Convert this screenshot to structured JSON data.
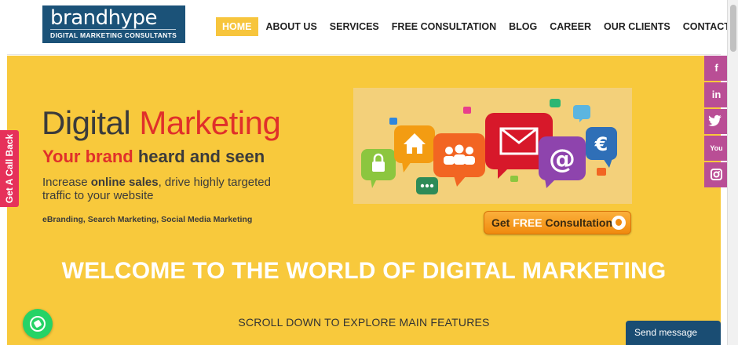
{
  "logo": {
    "wordmark_start": "brand",
    "wordmark_end": "hype",
    "tagline": "DIGITAL MARKETING CONSULTANTS",
    "background_color": "#1b5278"
  },
  "nav": {
    "items": [
      {
        "label": "HOME",
        "active": true
      },
      {
        "label": "ABOUT US",
        "active": false
      },
      {
        "label": "SERVICES",
        "active": false
      },
      {
        "label": "FREE CONSULTATION",
        "active": false
      },
      {
        "label": "BLOG",
        "active": false
      },
      {
        "label": "CAREER",
        "active": false
      },
      {
        "label": "OUR CLIENTS",
        "active": false
      },
      {
        "label": "CONTACT US",
        "active": false
      }
    ],
    "search_icon": "search-icon",
    "active_color": "#f7c53d"
  },
  "hero": {
    "background_color": "#f8c93c",
    "title_part1": "Digital ",
    "title_part2": "Marketing",
    "subtitle_part1": "Your brand ",
    "subtitle_part2": "heard and seen",
    "desc_part1": "Increase ",
    "desc_bold": "online sales",
    "desc_part2": ", drive highly targeted traffic to your website",
    "services_line": "eBranding, Search Marketing, Social Media Marketing",
    "cta_part1": "Get ",
    "cta_free": "FREE",
    "cta_part2": " Consultation",
    "welcome": "WELCOME TO THE WORLD OF DIGITAL MARKETING",
    "scroll_hint": "SCROLL DOWN TO EXPLORE MAIN FEATURES"
  },
  "illustration": {
    "icons": [
      "lock-icon",
      "home-icon",
      "group-icon",
      "mail-icon",
      "at-sign-icon",
      "euro-icon",
      "chat-dots-icon"
    ]
  },
  "callback": {
    "label": "Get A Call Back",
    "color": "#e6315a"
  },
  "social": {
    "color": "#b94e95",
    "items": [
      {
        "label": "f",
        "icon": "facebook-icon"
      },
      {
        "label": "in",
        "icon": "linkedin-icon"
      },
      {
        "label": "t",
        "icon": "twitter-icon"
      },
      {
        "label": "You",
        "icon": "youtube-icon"
      },
      {
        "label": "◎",
        "icon": "instagram-icon"
      }
    ]
  },
  "whatsapp": {
    "icon": "whatsapp-icon",
    "color": "#25d366"
  },
  "chat": {
    "label": "Send message",
    "color": "#1a4d73"
  }
}
